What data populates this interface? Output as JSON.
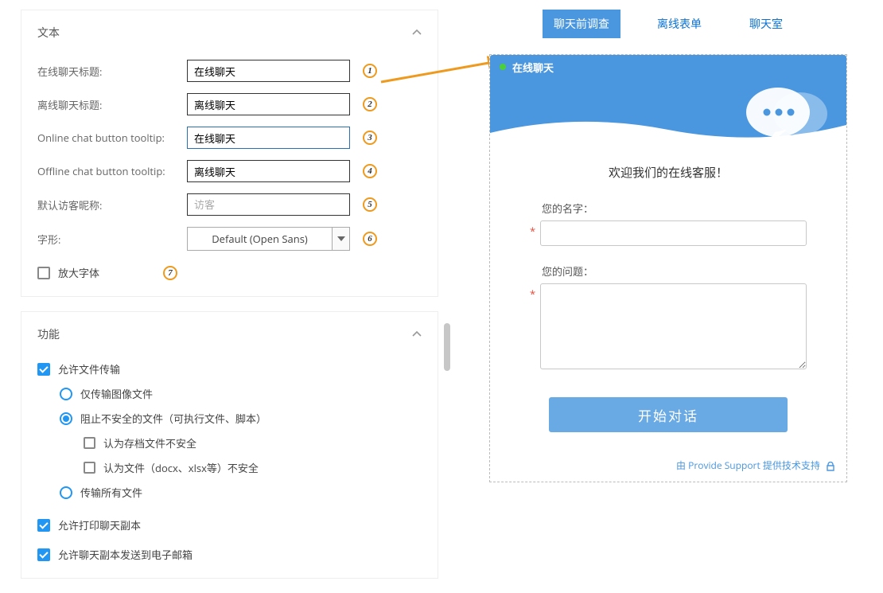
{
  "panels": {
    "text": {
      "title": "文本",
      "online_title_label": "在线聊天标题:",
      "online_title_value": "在线聊天",
      "offline_title_label": "离线聊天标题:",
      "offline_title_value": "离线聊天",
      "online_tooltip_label": "Online chat button tooltip:",
      "online_tooltip_value": "在线聊天",
      "offline_tooltip_label": "Offline chat button tooltip:",
      "offline_tooltip_value": "离线聊天",
      "default_nick_label": "默认访客昵称:",
      "default_nick_placeholder": "访客",
      "font_label": "字形:",
      "font_value": "Default (Open Sans)",
      "enlarge_font_label": "放大字体",
      "markers": {
        "m1": "1",
        "m2": "2",
        "m3": "3",
        "m4": "4",
        "m5": "5",
        "m6": "6",
        "m7": "7"
      }
    },
    "features": {
      "title": "功能",
      "allow_file": "允许文件传输",
      "only_images": "仅传输图像文件",
      "block_unsafe": "阻止不安全的文件（可执行文件、脚本）",
      "archive_unsafe": "认为存档文件不安全",
      "docx_unsafe": "认为文件（docx、xlsx等）不安全",
      "all_files": "传输所有文件",
      "allow_print": "允许打印聊天副本",
      "allow_email": "允许聊天副本发送到电子邮箱"
    }
  },
  "tabs": {
    "presurvey": "聊天前调查",
    "offline_form": "离线表单",
    "chatroom": "聊天室"
  },
  "widget": {
    "header_title": "在线聊天",
    "welcome": "欢迎我们的在线客服！",
    "name_label": "您的名字：",
    "question_label": "您的问题：",
    "start_button": "开始对话",
    "footer_prefix": "由 ",
    "footer_brand": "Provide Support",
    "footer_suffix": " 提供技术支持"
  }
}
